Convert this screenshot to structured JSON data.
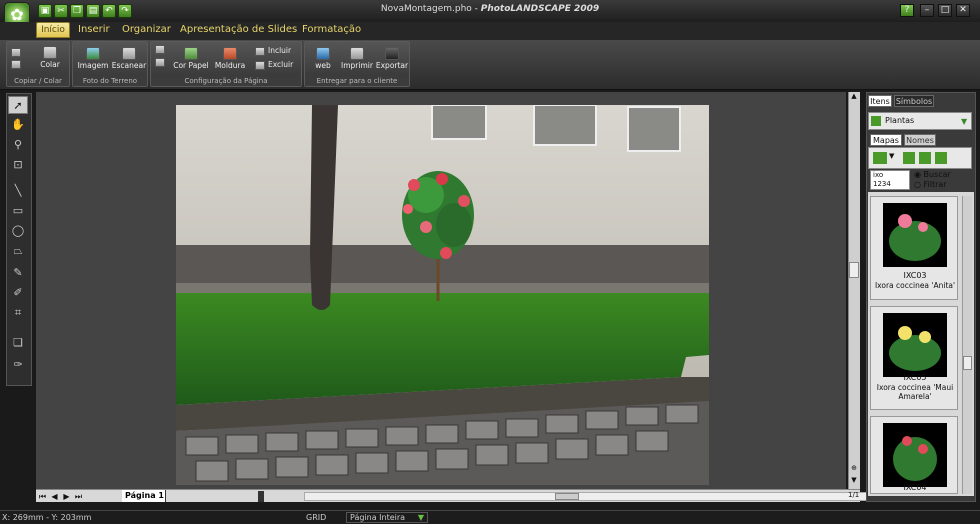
{
  "window": {
    "title_file": "NovaMontagem.pho - ",
    "title_app": "PhotoLANDSCAPE 2009",
    "help_label": "?",
    "minimize_label": "–",
    "maximize_label": "□",
    "close_label": "✕"
  },
  "quick_access": [
    "save-icon",
    "cut-icon",
    "copy-icon",
    "paste-icon",
    "undo-icon",
    "redo-icon"
  ],
  "menu": [
    "Início",
    "Inserir",
    "Organizar",
    "Apresentação de Slides",
    "Formatação"
  ],
  "ribbon": {
    "groups": [
      {
        "label": "Copiar / Colar",
        "buttons": [
          "Colar"
        ]
      },
      {
        "label": "Foto do Terreno",
        "buttons": [
          "Imagem",
          "Escanear"
        ]
      },
      {
        "label": "Configuração da Página",
        "buttons": [
          "Cor Papel",
          "Moldura",
          "Incluir",
          "Excluir"
        ]
      },
      {
        "label": "Entregar para o cliente",
        "buttons": [
          "web",
          "Imprimir",
          "Exportar"
        ]
      }
    ]
  },
  "tools": [
    "select-arrow",
    "hand",
    "zoom",
    "zoom-rect",
    "line",
    "rectangle",
    "ellipse",
    "polygon",
    "dropper",
    "paint",
    "crop",
    "layer",
    "pen"
  ],
  "canvas": {
    "page_tab": "Página 1",
    "page_index": "1/1"
  },
  "panel": {
    "tabs": [
      "Itens",
      "Símbolos"
    ],
    "category": "Plantas",
    "subtabs": [
      "Mapas",
      "Nomes"
    ],
    "search_text_1": "ixo",
    "search_text_2": "1234",
    "radio_search": "Buscar",
    "radio_filter": "Filtrar",
    "items": [
      {
        "code": "IXC03",
        "name": "Ixora coccinea 'Anita'"
      },
      {
        "code": "IXC05",
        "name": "Ixora coccinea 'Maui Amarela'"
      },
      {
        "code": "IXC04",
        "name": ""
      }
    ]
  },
  "status": {
    "coords": "X: 269mm - Y: 203mm",
    "grid": "GRID",
    "zoom": "Página Inteira"
  },
  "colors": {
    "accent": "#e8d56a",
    "green": "#5aa02c"
  }
}
